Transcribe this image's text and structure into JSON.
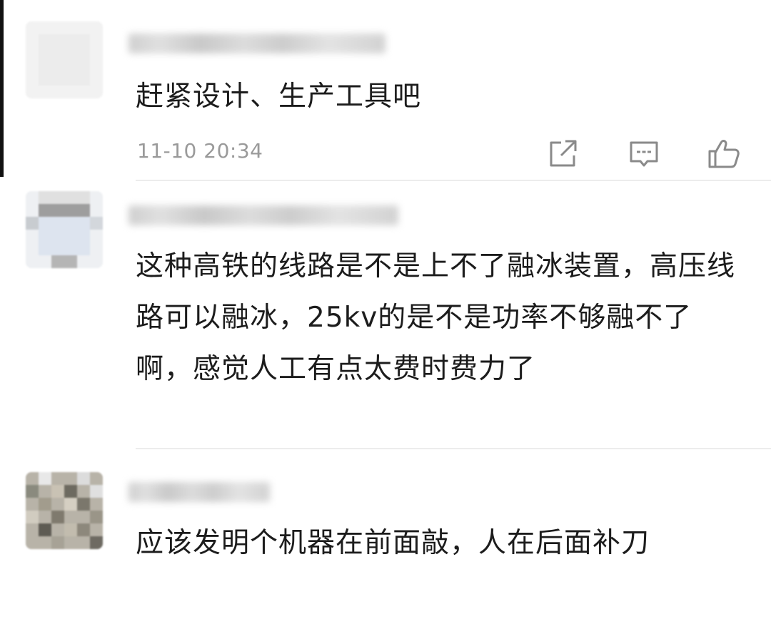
{
  "comments": [
    {
      "username": "",
      "text": "赶紧设计、生产工具吧",
      "timestamp": "11-10 20:34"
    },
    {
      "username": "",
      "text": "这种高铁的线路是不是上不了融冰装置，高压线路可以融冰，25kv的是不是功率不够融不了啊，感觉人工有点太费时费力了"
    },
    {
      "username": "",
      "text": "应该发明个机器在前面敲，人在后面补刀"
    }
  ],
  "actions": {
    "share_icon": "share-icon",
    "reply_icon": "reply-icon",
    "like_icon": "thumbs-up-icon"
  },
  "colors": {
    "text": "#1c1c1c",
    "meta": "#9a9a9a",
    "icon": "#8a8a8a",
    "divider": "#ececec"
  }
}
